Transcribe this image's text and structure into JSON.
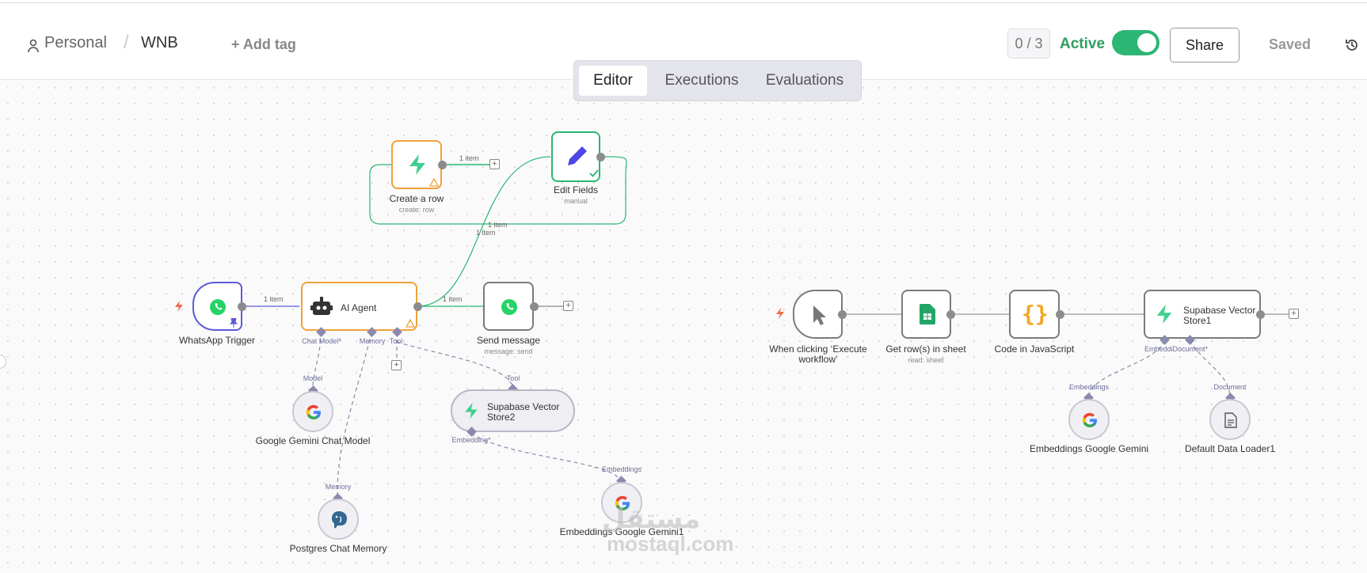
{
  "header": {
    "breadcrumb_personal": "Personal",
    "breadcrumb_sep": "/",
    "breadcrumb_workflow": "WNB",
    "add_tag": "+ Add tag",
    "counter": "0 / 3",
    "active_label": "Active",
    "share": "Share",
    "saved": "Saved"
  },
  "tabs": [
    "Editor",
    "Executions",
    "Evaluations"
  ],
  "nodes": {
    "create_row": {
      "title": "Create a row",
      "sub": "create: row"
    },
    "edit_fields": {
      "title": "Edit Fields",
      "sub": "manual"
    },
    "whatsapp_trigger": {
      "title": "WhatsApp Trigger"
    },
    "ai_agent": {
      "title": "AI Agent"
    },
    "send_message": {
      "title": "Send message",
      "sub": "message: send"
    },
    "gemini_chat": {
      "title": "Google Gemini Chat Model"
    },
    "postgres_memory": {
      "title": "Postgres Chat Memory"
    },
    "supabase_store2": {
      "title": "Supabase Vector Store2"
    },
    "embeddings_gemini1": {
      "title": "Embeddings Google Gemini1"
    },
    "manual_trigger": {
      "title": "When clicking ‘Execute workflow’"
    },
    "get_rows": {
      "title": "Get row(s) in sheet",
      "sub": "read: sheet"
    },
    "code_js": {
      "title": "Code in JavaScript"
    },
    "supabase_store1": {
      "title": "Supabase Vector Store1"
    },
    "embeddings_gemini": {
      "title": "Embeddings Google Gemini"
    },
    "data_loader": {
      "title": "Default Data Loader1"
    }
  },
  "ports": {
    "chat_model": "Chat Model*",
    "memory": "Memory",
    "tool": "Tool",
    "model": "Model",
    "memory_in": "Memory",
    "tool_in": "Tool",
    "embedding": "Embedding*",
    "embeddings_in": "Embeddings",
    "embedding_doc": "EmbeddiDocument*",
    "embeddings_in2": "Embeddings",
    "document_in": "Document"
  },
  "edge_labels": {
    "create_out": "1 item",
    "edit_loop": "1 item",
    "agent_edit": "1 item",
    "trigger_agent": "1 item",
    "agent_send": "1 item"
  },
  "watermark": {
    "arabic": "مستقل",
    "latin": "mostaql.com"
  },
  "colors": {
    "accent_green": "#2bb673",
    "warning_orange": "#f0a13a",
    "trigger_blue": "#5b5bd6"
  }
}
